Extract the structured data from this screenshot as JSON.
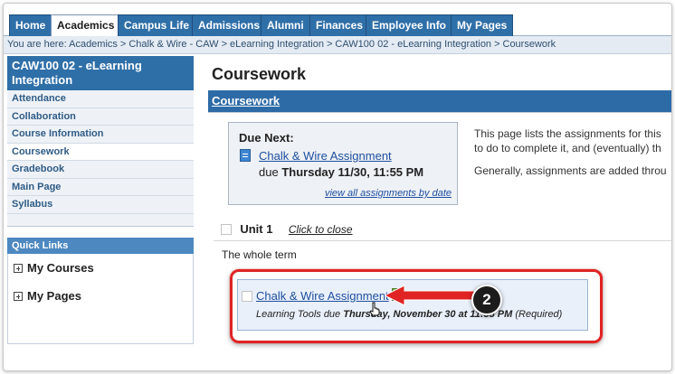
{
  "tabs": [
    {
      "label": "Home"
    },
    {
      "label": "Academics",
      "active": true
    },
    {
      "label": "Campus Life"
    },
    {
      "label": "Admissions"
    },
    {
      "label": "Alumni"
    },
    {
      "label": "Finances"
    },
    {
      "label": "Employee Info"
    },
    {
      "label": "My Pages"
    }
  ],
  "breadcrumb": {
    "prefix": "You are here:",
    "items": [
      "Academics",
      "Chalk & Wire - CAW",
      "eLearning Integration",
      "CAW100 02 - eLearning Integration",
      "Coursework"
    ],
    "separator": ">"
  },
  "sidebar": {
    "course_title": "CAW100 02 - eLearning Integration",
    "items": [
      "Attendance",
      "Collaboration",
      "Course Information",
      "Coursework",
      "Gradebook",
      "Main Page",
      "Syllabus"
    ],
    "selected": "Coursework",
    "quick_links_title": "Quick Links",
    "quick_links": [
      "My Courses",
      "My Pages"
    ]
  },
  "main": {
    "title": "Coursework",
    "section_link": "Coursework",
    "due_next": {
      "heading": "Due Next:",
      "assignment": "Chalk & Wire Assignment",
      "due_prefix": "due",
      "due_date": "Thursday 11/30, 11:55 PM",
      "view_all": "view all assignments by date"
    },
    "description_lines": [
      "This page lists the assignments for this",
      "to do to complete it, and (eventually) th",
      "Generally, assignments are added throu"
    ],
    "unit_label": "Unit 1",
    "click_to_close": "Click to close",
    "term_label": "The whole term",
    "assignment_card": {
      "title": "Chalk & Wire Assignment",
      "due_prefix": "Learning Tools due",
      "due_date_bold": "Thursday, November 30 at 11:55 PM",
      "status": "(Required)"
    }
  },
  "annotation": {
    "step_number": "2",
    "color": "#e02424"
  },
  "colors": {
    "primary_blue": "#2f6fa8",
    "section_blue": "#2d6ba6",
    "link_blue": "#1f4fa0"
  }
}
